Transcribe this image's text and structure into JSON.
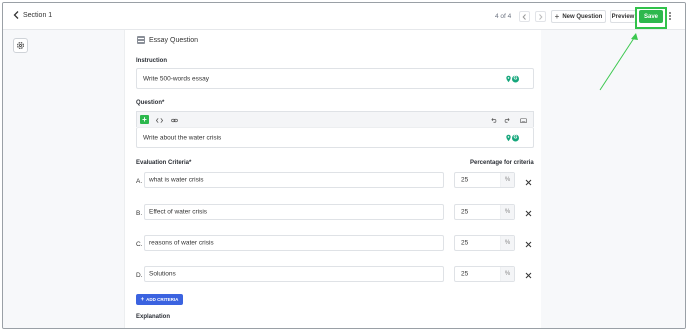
{
  "topbar": {
    "back_label": "Section 1",
    "pager": "4 of 4",
    "new_question_label": "New Question",
    "preview_label": "Preview",
    "save_label": "Save"
  },
  "question": {
    "type_label": "Essay Question",
    "instruction_label": "Instruction",
    "instruction_value": "Write 500-words essay",
    "question_label": "Question*",
    "question_value": "Write about the water crisis"
  },
  "criteria": {
    "header_label": "Evaluation Criteria*",
    "percentage_header": "Percentage for criteria",
    "percent_unit": "%",
    "items": [
      {
        "letter": "A.",
        "text": "what is water crisis",
        "percent": "25"
      },
      {
        "letter": "B.",
        "text": "Effect of water crisis",
        "percent": "25"
      },
      {
        "letter": "C.",
        "text": "reasons of water crisis",
        "percent": "25"
      },
      {
        "letter": "D.",
        "text": "Solutions",
        "percent": "25"
      }
    ],
    "add_label": "ADD CRITERIA"
  },
  "explanation_label": "Explanation",
  "colors": {
    "save_green": "#2db84d",
    "highlight_green": "#31c24a",
    "add_blue": "#3b63e0",
    "grammarly_green": "#15a67b"
  },
  "icons": [
    "chevron-left-icon",
    "chevron-right-icon",
    "plus-icon",
    "kebab-menu-icon",
    "gear-icon",
    "essay-icon",
    "location-pin-icon",
    "grammarly-icon",
    "code-icon",
    "link-icon",
    "undo-icon",
    "redo-icon",
    "keyboard-icon",
    "close-icon",
    "annotation-arrow-icon"
  ]
}
